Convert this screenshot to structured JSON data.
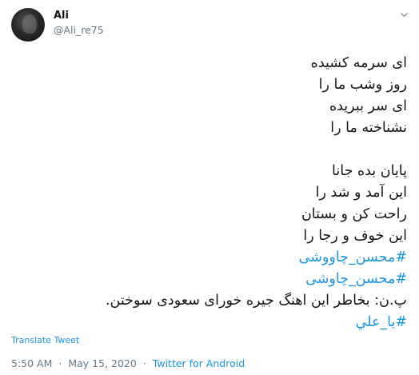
{
  "tweet": {
    "author_name": "Ali",
    "author_handle": "@Ali_re75",
    "lines": [
      "ای سرمه کشیده",
      "روز وشب ما را",
      "ای سر ببریده",
      "نشناخته ما را",
      "",
      "پایان بده جانا",
      "این آمد و شد را",
      "راحت کن و بستان",
      "این خوف و رجا را"
    ],
    "hashtags_top": [
      "#محسن_چاووشی",
      "#محسن_چاوشی"
    ],
    "postscript": "پ.ن: بخاطر این اهنگ جیره خورای سعودی سوختن.",
    "hashtag_bottom": "#یا_علي",
    "translate_label": "Translate Tweet",
    "time": "5:50 AM",
    "separator": "·",
    "date": "May 15, 2020",
    "source": "Twitter for Android"
  },
  "icons": {
    "more": "chevron-down-icon",
    "avatar": "profile-photo"
  },
  "colors": {
    "link": "#1b95e0",
    "secondary": "#657786",
    "text": "#14171a"
  }
}
